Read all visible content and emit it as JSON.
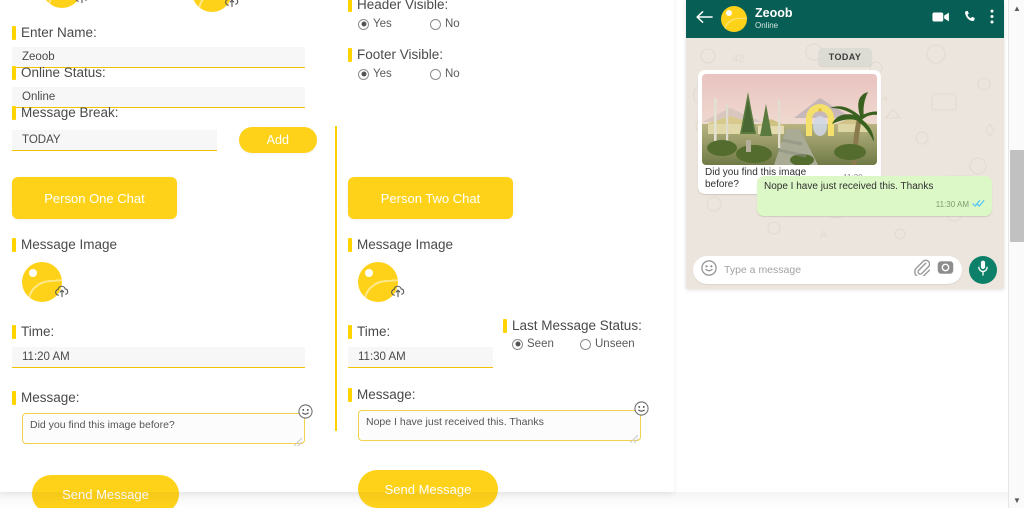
{
  "form": {
    "name_label": "Enter Name:",
    "name_value": "Zeoob",
    "status_label": "Online Status:",
    "status_value": "Online",
    "break_label": "Message Break:",
    "break_value": "TODAY",
    "add_button": "Add",
    "header_visible_label": "Header Visible:",
    "footer_visible_label": "Footer Visible:",
    "yes_label": "Yes",
    "no_label": "No",
    "header_visible_value": "Yes",
    "footer_visible_value": "Yes"
  },
  "person_one": {
    "section_title": "Person One Chat",
    "message_image_label": "Message Image",
    "time_label": "Time:",
    "time_value": "11:20 AM",
    "message_label": "Message:",
    "message_value": "Did you find this image before?",
    "send_button": "Send Message"
  },
  "person_two": {
    "section_title": "Person Two Chat",
    "message_image_label": "Message Image",
    "time_label": "Time:",
    "time_value": "11:30 AM",
    "message_label": "Message:",
    "message_value": "Nope I have just received this. Thanks",
    "send_button": "Send Message",
    "last_status_label": "Last Message Status:",
    "seen_label": "Seen",
    "unseen_label": "Unseen",
    "last_status_value": "Seen"
  },
  "whatsapp": {
    "contact_name": "Zeoob",
    "contact_status": "Online",
    "day_divider": "TODAY",
    "incoming": {
      "text": "Did you find this image before?",
      "time": "11:20 AM"
    },
    "outgoing": {
      "text": "Nope I have just received this. Thanks",
      "time": "11:30 AM"
    },
    "input_placeholder": "Type a message"
  },
  "colors": {
    "accent_yellow": "#ffd21a",
    "wa_header_green": "#075e54",
    "wa_outgoing_green": "#dcf8c6",
    "wa_background": "#ece5dd",
    "wa_mic_green": "#0c8069"
  }
}
